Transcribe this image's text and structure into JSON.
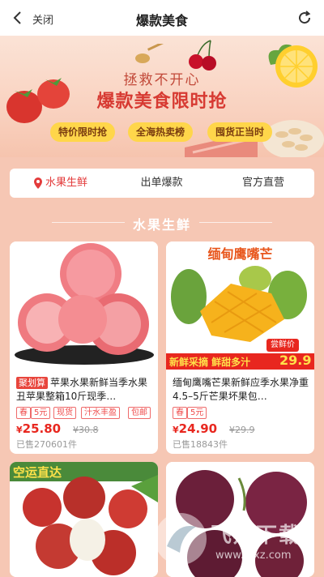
{
  "topbar": {
    "close_label": "关闭",
    "title": "爆款美食"
  },
  "banner": {
    "kicker": "拯救不开心",
    "title": "爆款美食限时抢",
    "pills": [
      "特价限时抢",
      "全海热卖榜",
      "囤货正当时"
    ]
  },
  "tabs": [
    {
      "label": "水果生鲜",
      "active": true
    },
    {
      "label": "出单爆款",
      "active": false
    },
    {
      "label": "官方直营",
      "active": false
    }
  ],
  "section": {
    "title": "水果生鲜"
  },
  "products": [
    {
      "badge": "聚划算",
      "title": "苹果水果新鲜当季水果丑苹果整箱10斤现季…",
      "chips": [
        "春",
        "5元",
        "现货",
        "汁水丰盈",
        "包邮"
      ],
      "price_symbol": "¥",
      "price": "25.80",
      "old_price": "¥30.8",
      "sold": "已售270601件"
    },
    {
      "banner_text": "缅甸鹰嘴芒",
      "strip_left": "新鲜采摘 鲜甜多汁",
      "strip_price": "29.9",
      "strip_tag": "尝鲜价",
      "title": "缅甸鹰嘴芒果新鲜应季水果净重4.5–5斤芒果坏果包…",
      "chips": [
        "春",
        "5元"
      ],
      "price_symbol": "¥",
      "price": "24.90",
      "old_price": "¥29.9",
      "sold": "已售18843件"
    },
    {
      "overlay_text": "空运直达"
    },
    {}
  ],
  "watermark": {
    "text": "飞翔下载",
    "sub": "www.fxxz.com"
  },
  "colors": {
    "accent": "#e8271f",
    "banner_title": "#d73a32",
    "pill": "#ffd64a",
    "page_bg": "#f6c7b4"
  }
}
